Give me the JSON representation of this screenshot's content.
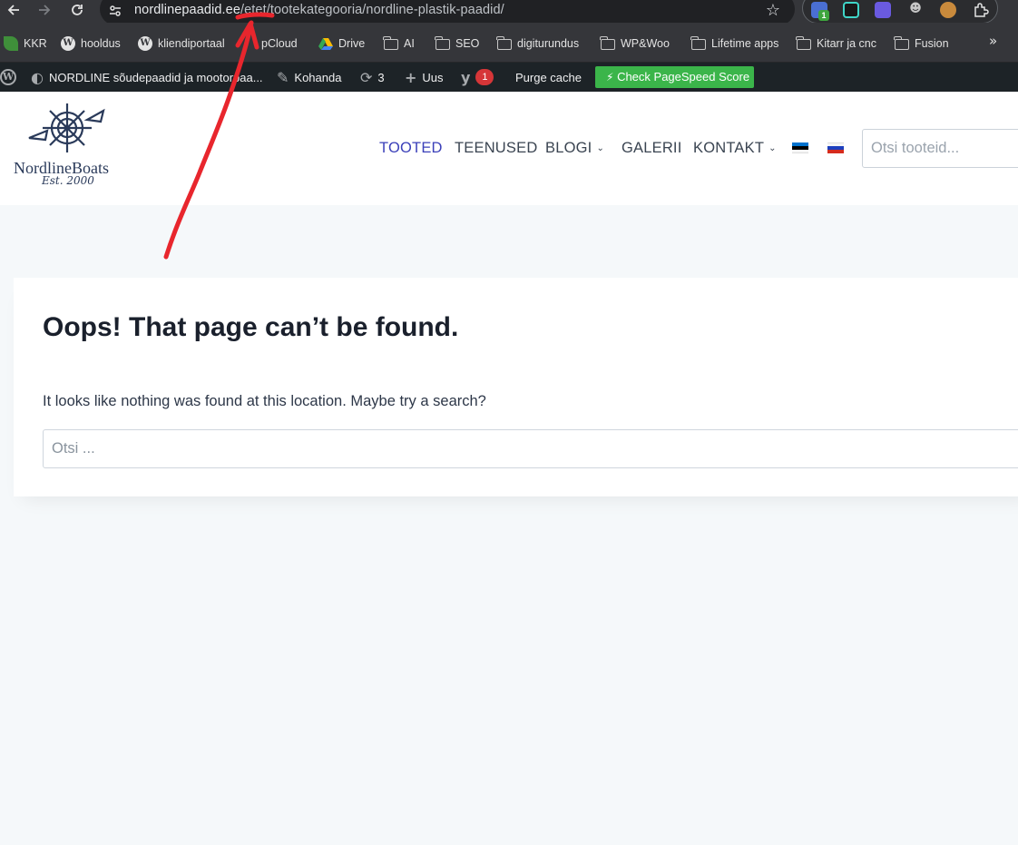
{
  "browser": {
    "url_host": "nordlinepaadid.ee",
    "url_path": "/etet/tootekategooria/nordline-plastik-paadid/",
    "extension_badge": "1",
    "bookmarks": [
      {
        "label": "KKR",
        "icon": "leaf-icon"
      },
      {
        "label": "hooldus",
        "icon": "wordpress-icon"
      },
      {
        "label": "kliendiportaal",
        "icon": "wordpress-icon"
      },
      {
        "label": "pCloud",
        "icon": "pcloud-icon"
      },
      {
        "label": "Drive",
        "icon": "google-drive-icon"
      },
      {
        "label": "AI",
        "icon": "folder-icon"
      },
      {
        "label": "SEO",
        "icon": "folder-icon"
      },
      {
        "label": "digiturundus",
        "icon": "folder-icon"
      },
      {
        "label": "WP&Woo",
        "icon": "folder-icon"
      },
      {
        "label": "Lifetime apps",
        "icon": "folder-icon"
      },
      {
        "label": "Kitarr ja cnc",
        "icon": "folder-icon"
      },
      {
        "label": "Fusion",
        "icon": "folder-icon"
      }
    ]
  },
  "adminbar": {
    "site_name": "NORDLINE sõudepaadid ja mootorpaa...",
    "customize": "Kohanda",
    "updates_count": "3",
    "new": "Uus",
    "yoast_count": "1",
    "purge": "Purge cache",
    "pagespeed": "Check PageSpeed Score"
  },
  "site": {
    "logo_name": "NordlineBoats",
    "logo_est": "Est. 2000",
    "nav": [
      "TOOTED",
      "TEENUSED",
      "BLOGI",
      "GALERII",
      "KONTAKT"
    ],
    "search_placeholder": "Otsi tooteid..."
  },
  "notfound": {
    "title": "Oops! That page can’t be found.",
    "text": "It looks like nothing was found at this location. Maybe try a search?",
    "search_placeholder": "Otsi ..."
  },
  "colors": {
    "nav_active": "#3b40b9",
    "pagespeed_button": "#3bb54a",
    "annotation": "#e8262d",
    "admin_bar": "#1d2327"
  }
}
